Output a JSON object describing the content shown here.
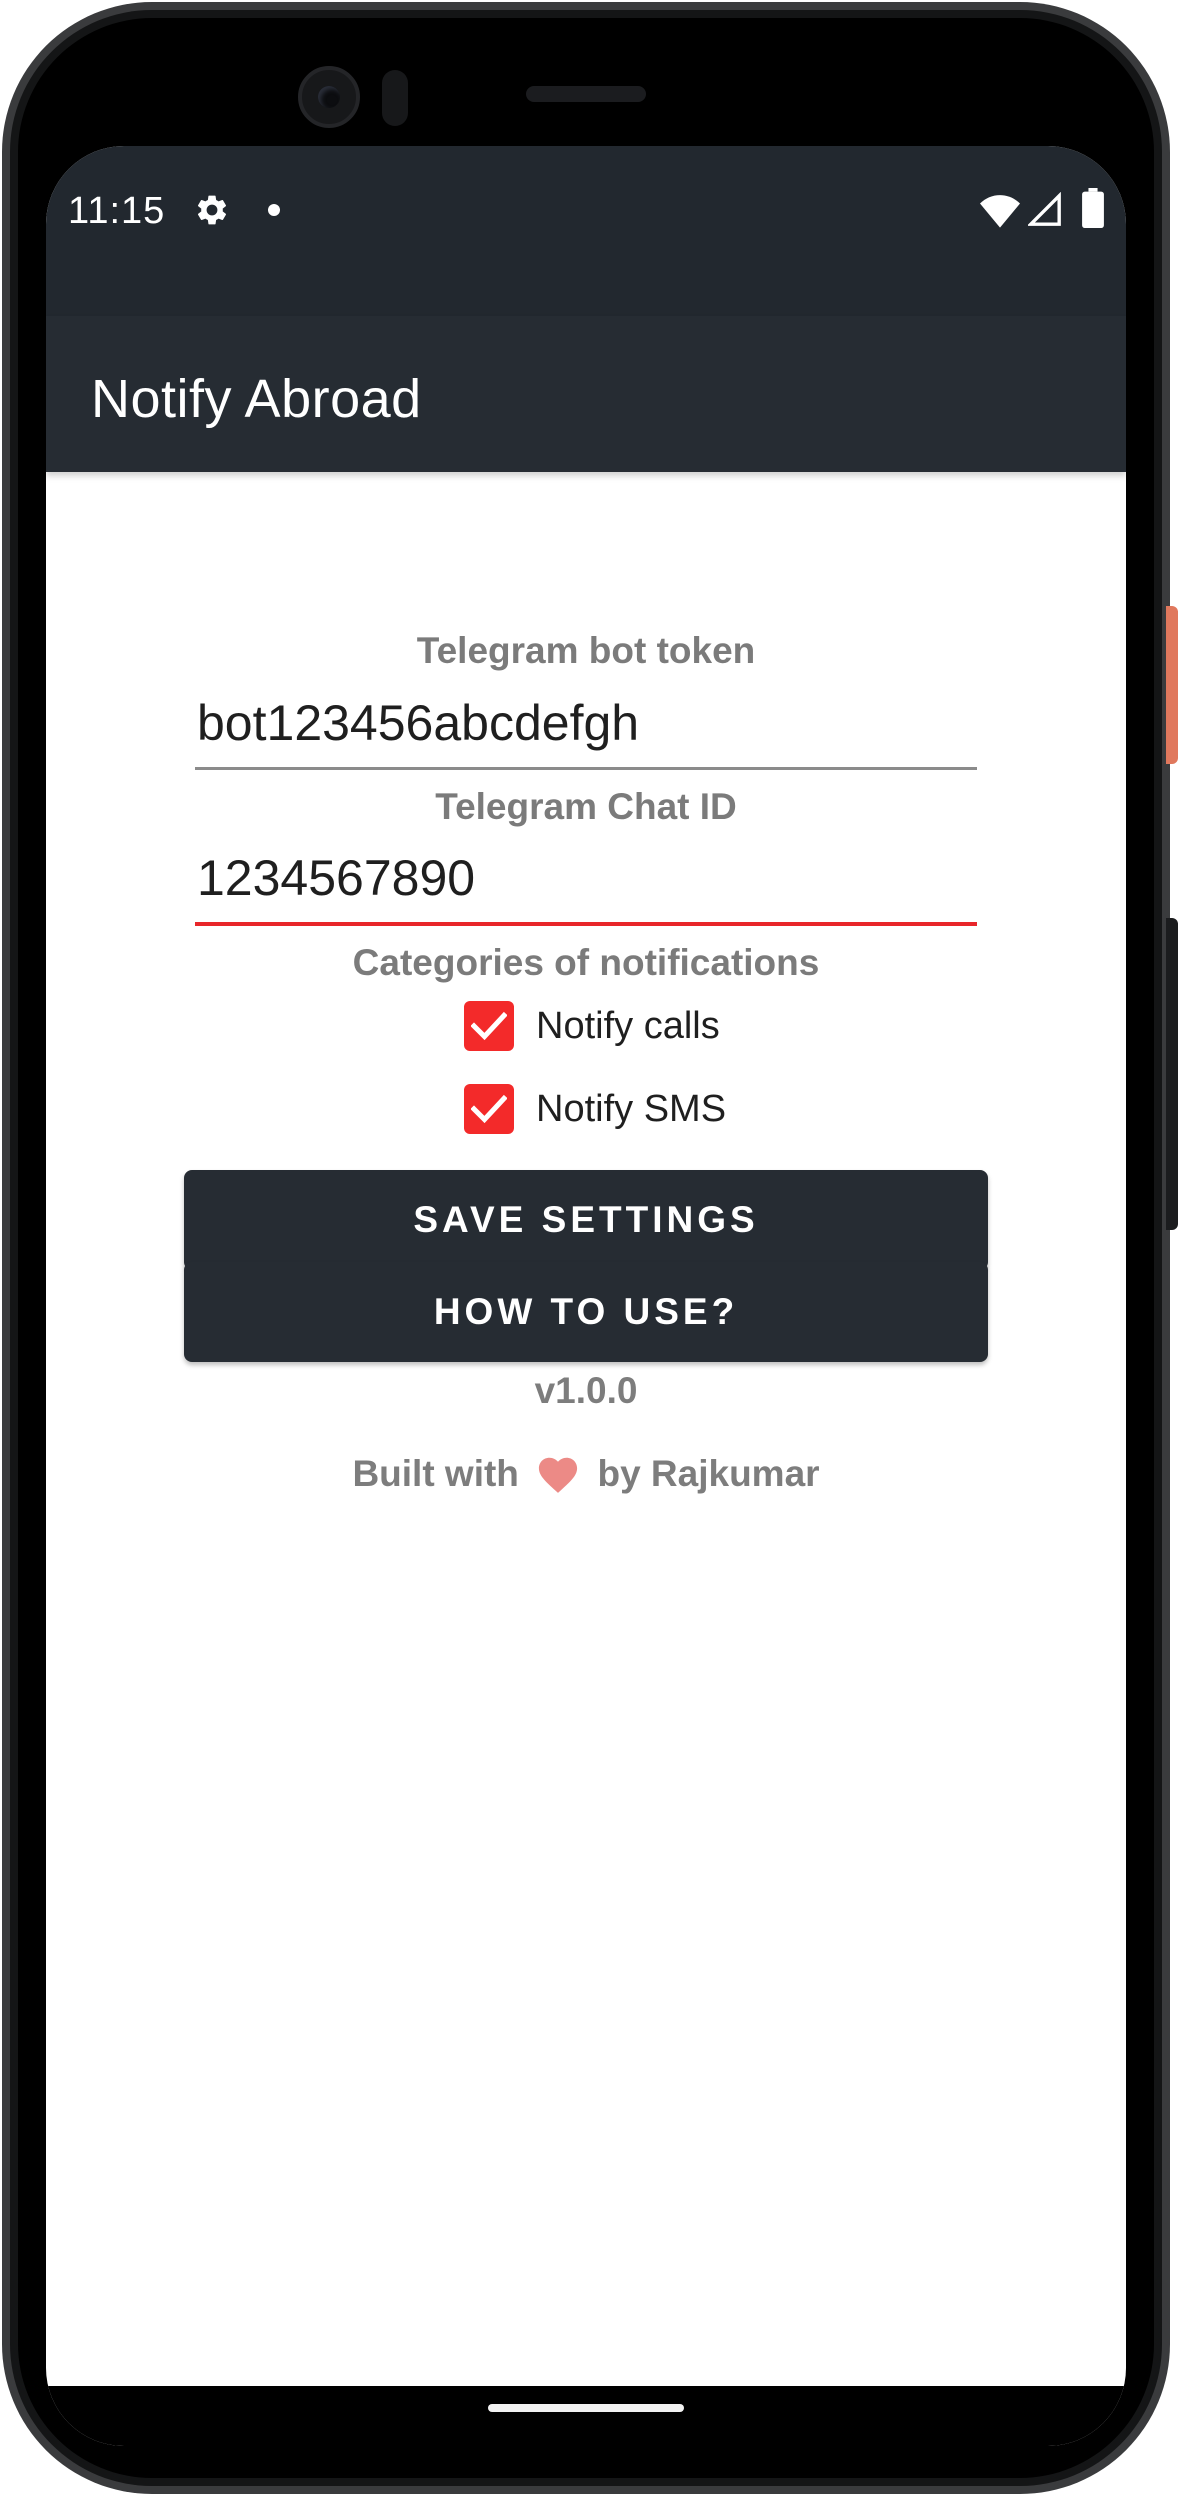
{
  "status_bar": {
    "time": "11:15",
    "icons": [
      "settings-icon",
      "notification-dot-icon",
      "wifi-icon",
      "cell-signal-icon",
      "battery-icon"
    ]
  },
  "app_bar": {
    "title": "Notify Abroad",
    "color": "#262c33"
  },
  "form": {
    "bot_token": {
      "label": "Telegram bot token",
      "value": "bot123456abcdefgh"
    },
    "chat_id": {
      "label": "Telegram Chat ID",
      "value": "1234567890"
    },
    "categories": {
      "label": "Categories of notifications",
      "items": [
        {
          "label": "Notify calls",
          "checked": true
        },
        {
          "label": "Notify SMS",
          "checked": true
        }
      ]
    }
  },
  "buttons": {
    "save": "SAVE SETTINGS",
    "how_to_use": "HOW TO USE?"
  },
  "footer": {
    "version": "v1.0.0",
    "built_with_prefix": "Built with",
    "built_with_suffix": "by Rajkumar"
  },
  "colors": {
    "accent": "#f32a2a",
    "primary_dark": "#262c33",
    "label_gray": "#7b7b7b"
  }
}
